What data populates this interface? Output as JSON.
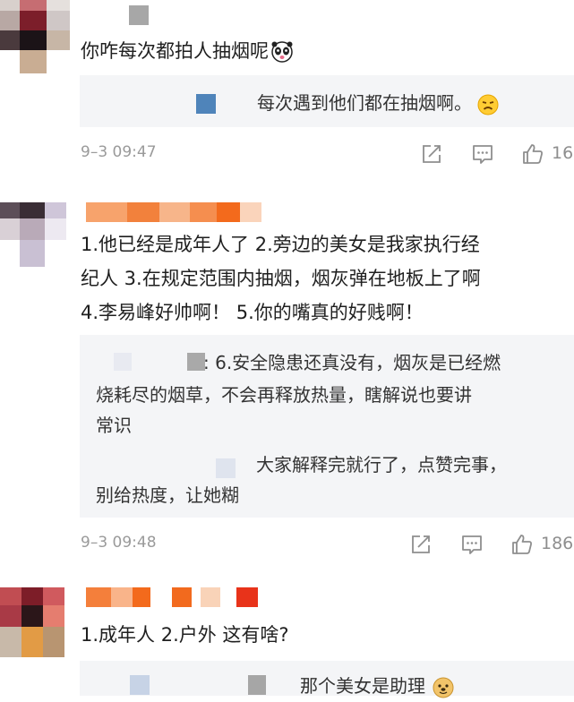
{
  "comments": [
    {
      "text": "你咋每次都拍人抽烟呢",
      "emoji": "panda-face-icon",
      "reply_lines": [
        "每次遇到他们都在抽烟啊。"
      ],
      "reply_emoji": "sad-face-icon",
      "time": "9–3 09:47",
      "likes": "16"
    },
    {
      "lines": [
        "1.他已经是成年人了 2.旁边的美女是我家执行经",
        "纪人 3.在规定范围内抽烟，烟灰弹在地板上了啊",
        "4.李易峰好帅啊！ 5.你的嘴真的好贱啊！"
      ],
      "replies": [
        {
          "lines": [
            ": 6.安全隐患还真没有，烟灰是已经燃",
            "烧耗尽的烟草，不会再释放热量，瞎解说也要讲",
            "常识"
          ]
        },
        {
          "lines": [
            "大家解释完就行了，点赞完事，",
            "别给热度，让她糊"
          ]
        }
      ],
      "time": "9–3 09:48",
      "likes": "186"
    },
    {
      "text": "1.成年人 2.户外 这有啥?",
      "reply_lines": [
        "那个美女是助理"
      ],
      "reply_emoji": "doge-face-icon"
    }
  ],
  "colors": {
    "meta_gray": "#9a9a9a",
    "reply_bg": "#f4f5f7",
    "orange": "#f36a1c"
  }
}
